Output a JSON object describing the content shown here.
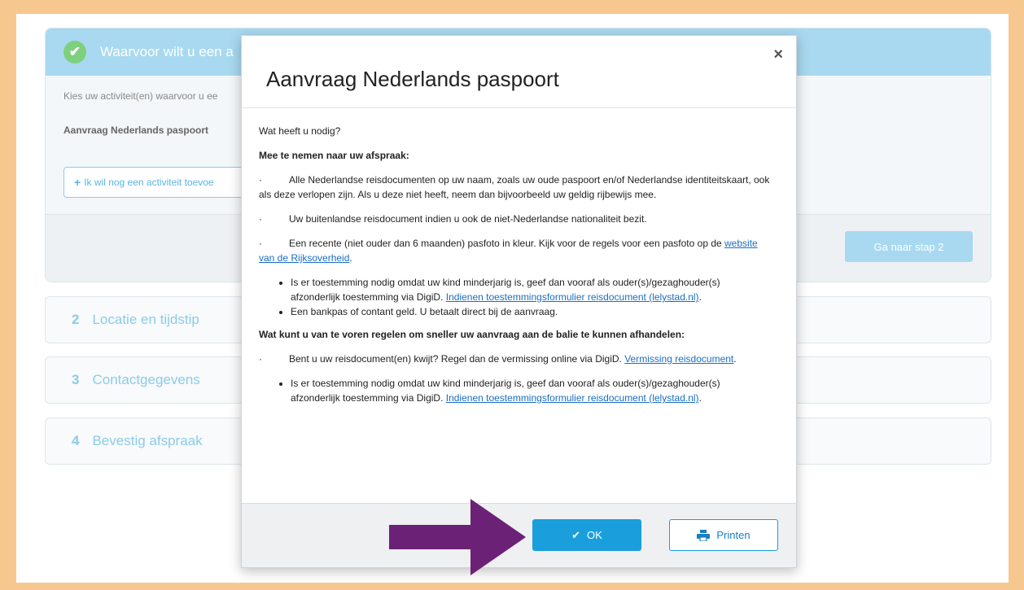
{
  "wizard": {
    "step1": {
      "title": "Waarvoor wilt u een a",
      "hint": "Kies uw activiteit(en) waarvoor u ee",
      "activity": "Aanvraag Nederlands paspoort",
      "add_button": "Ik wil nog een activiteit toevoe",
      "next_button": "Ga naar stap 2"
    },
    "steps": [
      {
        "num": "2",
        "label": "Locatie en tijdstip"
      },
      {
        "num": "3",
        "label": "Contactgegevens"
      },
      {
        "num": "4",
        "label": "Bevestig afspraak"
      }
    ]
  },
  "modal": {
    "title": "Aanvraag Nederlands paspoort",
    "close": "×",
    "intro": "Wat heeft u nodig?",
    "section1_heading": "Mee te nemen naar uw afspraak:",
    "item1": "Alle Nederlandse reisdocumenten op uw naam, zoals uw oude paspoort en/of Nederlandse identiteitskaart, ook als deze verlopen zijn. Als u deze niet heeft, neem dan bijvoorbeeld uw geldig rijbewijs mee.",
    "item2": "Uw buitenlandse reisdocument indien u ook de niet-Nederlandse nationaliteit bezit.",
    "item3_text": "Een recente (niet ouder dan 6 maanden) pasfoto in kleur. Kijk voor de regels voor een pasfoto op de ",
    "item3_link": "website van de Rijksoverheid",
    "bullet1_text": "Is er toestemming nodig omdat uw kind minderjarig is, geef dan vooraf als ouder(s)/gezaghouder(s) afzonderlijk toestemming via DigiD. ",
    "bullet1_link": "Indienen toestemmingsformulier reisdocument (lelystad.nl)",
    "bullet2": "Een bankpas of contant geld. U betaalt direct bij de aanvraag.",
    "section2_heading": "Wat kunt u van te voren regelen om sneller uw aanvraag aan de balie te kunnen afhandelen:",
    "item4_text": "Bent u uw reisdocument(en) kwijt? Regel dan de vermissing online via DigiD. ",
    "item4_link": "Vermissing reisdocument",
    "bullet3_text": "Is er toestemming nodig omdat uw kind minderjarig is, geef dan vooraf als ouder(s)/gezaghouder(s) afzonderlijk toestemming via DigiD. ",
    "bullet3_link": "Indienen toestemmingsformulier reisdocument (lelystad.nl)",
    "ok_button": "OK",
    "print_button": "Printen",
    "dot": "·",
    "period": "."
  },
  "colors": {
    "frame": "#f6c88f",
    "accent": "#1a9fdc",
    "arrow": "#6b2176"
  }
}
